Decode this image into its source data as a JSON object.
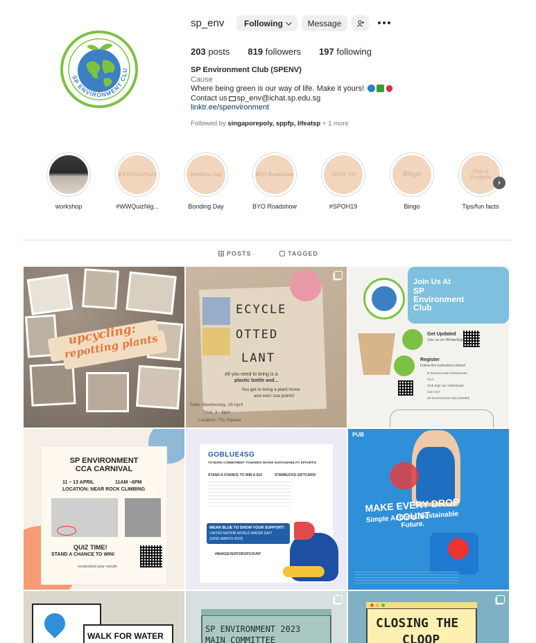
{
  "profile": {
    "username": "sp_env",
    "following_btn": "Following",
    "message_btn": "Message",
    "stats": {
      "posts_count": "203",
      "posts_label": "posts",
      "followers_count": "819",
      "followers_label": "followers",
      "following_count": "197",
      "following_label": "following"
    },
    "full_name": "SP Environment Club (SPENV)",
    "category": "Cause",
    "bio_line1": "Where being green is our way of life. Make it yours!",
    "bio_contact_prefix": "Contact us",
    "bio_contact_email": "sp_env@ichat.sp.edu.sg",
    "link": "linktr.ee/spenvironment",
    "followed_prefix": "Followed by",
    "followed_by": "singaporepoly, sppfp, lifeatsp",
    "followed_more": "+ 1 more",
    "avatar_text": "SP ENVIRONMENT CLUB"
  },
  "highlights": [
    {
      "label": "workshop",
      "cover": ""
    },
    {
      "label": "#WWQuizNig...",
      "cover": "#WWQuizNight"
    },
    {
      "label": "Bonding Day",
      "cover": "Bonding Day"
    },
    {
      "label": "BYO Roadshow",
      "cover": "BYO Roadshow"
    },
    {
      "label": "#SPOH19",
      "cover": "SPOH '19"
    },
    {
      "label": "Bingo",
      "cover": "Bingo"
    },
    {
      "label": "Tips/fun facts",
      "cover": "Tips & Funfacts"
    }
  ],
  "tabs": {
    "posts": "POSTS",
    "tagged": "TAGGED"
  },
  "posts": {
    "p1": {
      "title_a": "upcycling:",
      "title_b": "repotting plants"
    },
    "p2": {
      "line1": "ECYCLE",
      "line2": "OTTED",
      "line3": "LANT",
      "body1": "All you need to bring is a",
      "body2": "plastic bottle and...",
      "body3": "You get to bring a plant home",
      "body4": "and earn cca points!",
      "date": "Date: Wednesday, 26 April",
      "time": "Time: 3 - 6pm",
      "loc": "Location: T11 Square"
    },
    "p3": {
      "heading1": "Join Us At",
      "heading2": "SP",
      "heading3": "Environment",
      "heading4": "Club",
      "updated": "Get Updated",
      "updated_sub": "Join us on WhatsApp!",
      "register": "Register",
      "register_sub": "Follow the instructions below!",
      "steps": [
        "E-Services and S-Resources",
        "CCA",
        "Club Sign Up / Withdrawal",
        "Join CCA",
        "SP Environment Club (OS060)"
      ]
    },
    "p4": {
      "title1": "SP ENVIRONMENT",
      "title2": "CCA CARNIVAL",
      "dates": "11 – 13 APRIL",
      "time": "11AM –6PM",
      "location": "LOCATION: NEAR ROCK CLIMBING",
      "quiz": "QUIZ TIME!",
      "win": "STAND A CHANCE TO WIN!",
      "screenshot": "screenshot your results"
    },
    "p5": {
      "title": "GOBLUE4SG",
      "sub": "TO MARK COMMITMENT TOWARDS WATER SUSTAINABILITY EFFORTS!",
      "chance": "STAND A CHANCE TO WIN A $10",
      "brand": "STARBUCKS GIFTCARD!",
      "wear": "WEAR BLUE TO SHOW YOUR SUPPORT!",
      "wwd": "UNITED NATION WORLD WATER DAY!",
      "date": "(22ND MARCH 2023)",
      "hashtag": "#MAKEEVERYDROPCOUNT"
    },
    "p6": {
      "brand": "PUB",
      "title": "MAKE EVERY DROP COUNT",
      "sub": "Simple Actions. Sustainable Future."
    },
    "p7": {
      "title": "WALK FOR WATER"
    },
    "p8": {
      "title1": "SP ENVIRONMENT 2023",
      "title2": "MAIN COMMITTEE"
    },
    "p9": {
      "title1": "CLOSING THE",
      "title2": "CLOOP"
    }
  },
  "colors": {
    "link": "#00376b",
    "muted": "#737373",
    "highlight_bg": "#f1d6bd",
    "club_green": "#7cc242",
    "club_blue": "#3d7fc3"
  }
}
